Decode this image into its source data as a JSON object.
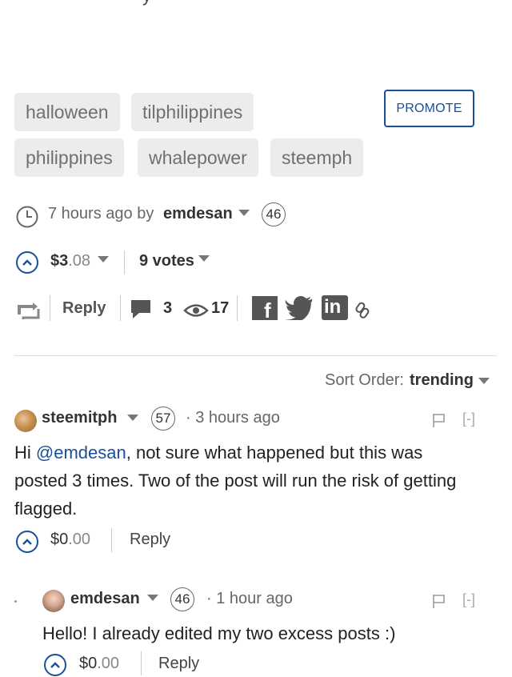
{
  "top_fragment": "y",
  "tags": [
    "halloween",
    "tilphilippines",
    "philippines",
    "whalepower",
    "steemph"
  ],
  "promote_label": "PROMOTE",
  "post": {
    "time": "7 hours ago by",
    "author": "emdesan",
    "reputation": "46",
    "payout_main": "$3",
    "payout_decimal": ".08",
    "votes": "9 votes",
    "reply_label": "Reply",
    "comment_count": "3",
    "view_count": "17"
  },
  "sort": {
    "label": "Sort Order:",
    "value": "trending"
  },
  "comments": [
    {
      "author": "steemitph",
      "reputation": "57",
      "time": "3 hours ago",
      "collapse": "[-]",
      "mention": "@emdesan",
      "text_prefix": "Hi ",
      "text_line1_rest": ", not sure what happened but this was",
      "text_line2": "posted 3 times. Two of the post will run the risk of getting",
      "text_line3": "flagged.",
      "payout_main": "$0",
      "payout_decimal": ".00",
      "reply_label": "Reply"
    },
    {
      "author": "emdesan",
      "reputation": "46",
      "time": "1 hour ago",
      "collapse": "[-]",
      "text": "Hello! I already edited my two excess posts :)",
      "payout_main": "$0",
      "payout_decimal": ".00",
      "reply_label": "Reply"
    }
  ],
  "colors": {
    "accent": "#1a5099",
    "tag_bg": "#ececec",
    "text": "#333333"
  }
}
